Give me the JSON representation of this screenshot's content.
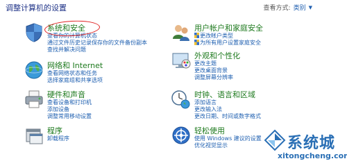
{
  "header": {
    "title": "调整计算机的设置",
    "view_by_label": "查看方式:",
    "view_by_value": "类别"
  },
  "categories": {
    "system_security": {
      "title": "系统和安全",
      "links": [
        "查看你的计算机状态",
        "通过文件历史记录保存你的文件备份副本",
        "查找并解决问题"
      ]
    },
    "user_accounts": {
      "title": "用户帐户和家庭安全",
      "links": [
        "更改帐户类型",
        "为所有用户设置家庭安全"
      ]
    },
    "network": {
      "title": "网络和 Internet",
      "links": [
        "查看网络状态和任务",
        "选择家庭组和共享选项"
      ]
    },
    "appearance": {
      "title": "外观和个性化",
      "links": [
        "更改主题",
        "更改桌面背景",
        "调整屏幕分辨率"
      ]
    },
    "hardware": {
      "title": "硬件和声音",
      "links": [
        "查看设备和打印机",
        "添加设备",
        "调整常用移动设置"
      ]
    },
    "clock": {
      "title": "时钟、语言和区域",
      "links": [
        "添加语言",
        "更改输入法",
        "更改日期、时间或数字格式"
      ]
    },
    "programs": {
      "title": "程序",
      "links": [
        "卸载程序"
      ]
    },
    "ease": {
      "title": "轻松使用",
      "links": [
        "使用 Windows 建议的设置",
        "优化视觉显示"
      ]
    }
  },
  "watermark": {
    "brand": "系统城",
    "domain": "xitongcheng.com"
  }
}
